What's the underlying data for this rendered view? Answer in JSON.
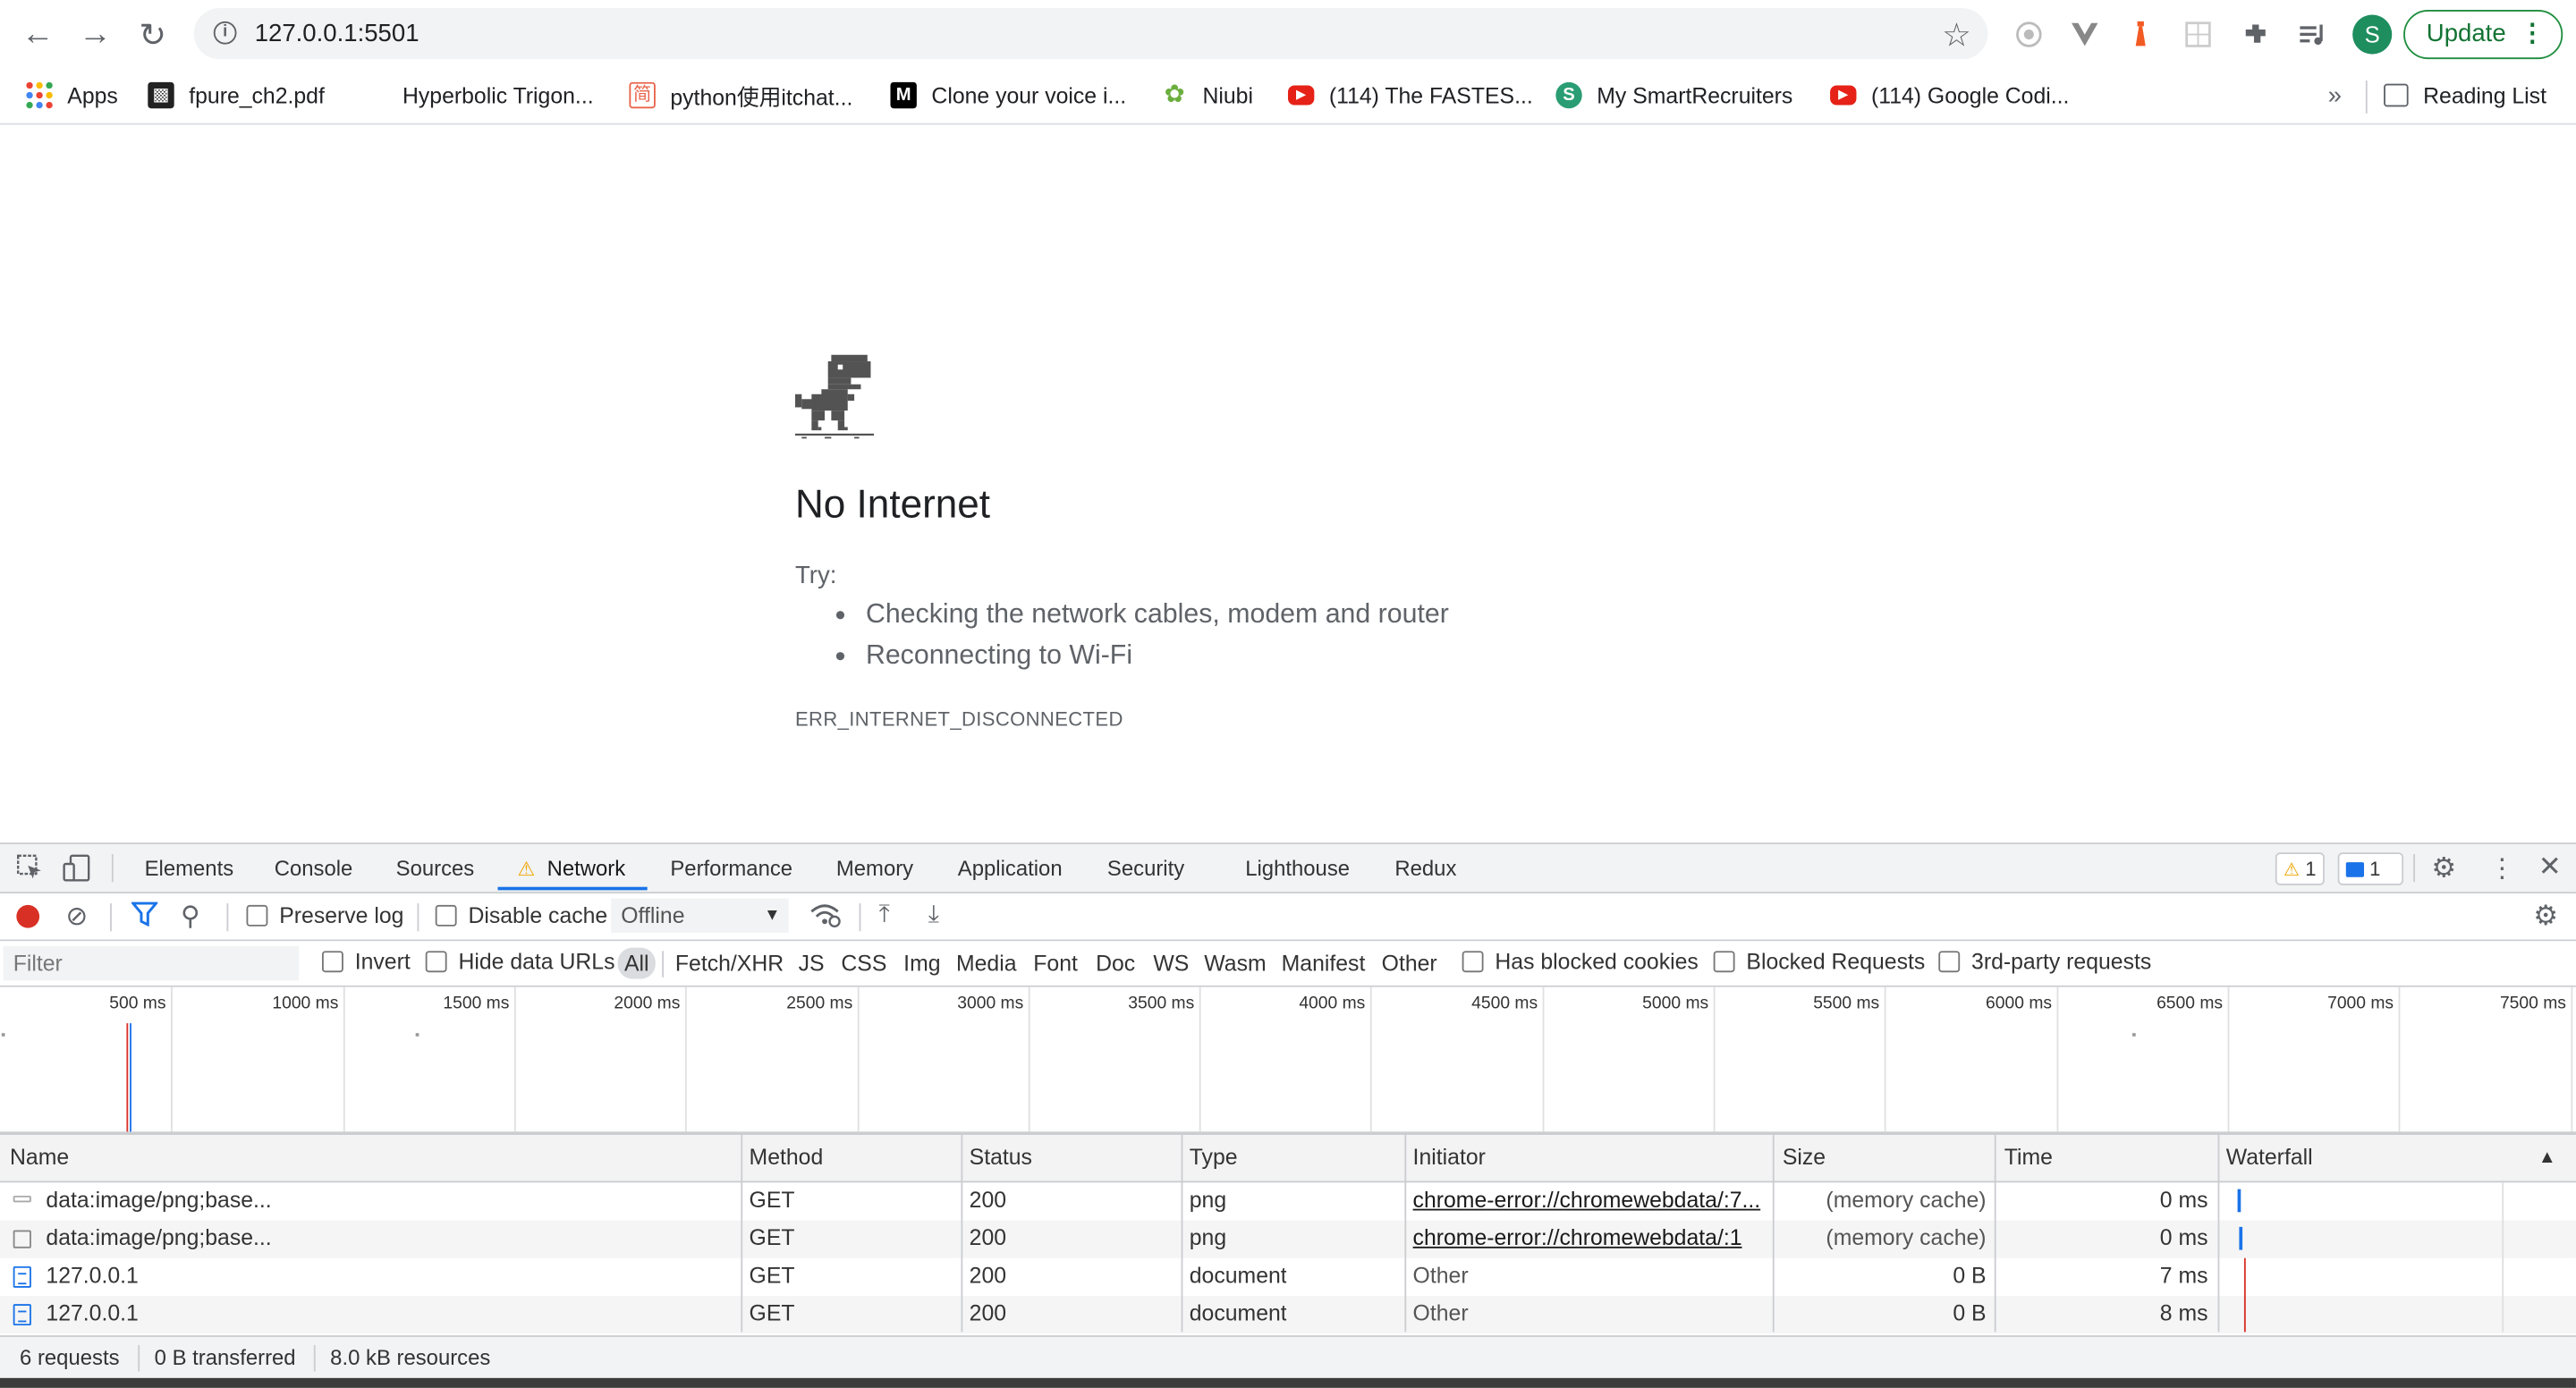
{
  "browser": {
    "url": "127.0.0.1:5501",
    "update_label": "Update",
    "avatar_letter": "S",
    "bookmarks": [
      {
        "label": "Apps",
        "icon": "apps-grid-icon"
      },
      {
        "label": "fpure_ch2.pdf",
        "icon": "pdf-icon"
      },
      {
        "label": "Hyperbolic Trigon...",
        "icon": "blank-icon"
      },
      {
        "label": "python使用itchat...",
        "icon": "jianshu-icon"
      },
      {
        "label": "Clone your voice i...",
        "icon": "medium-icon"
      },
      {
        "label": "Niubi",
        "icon": "leaf-icon"
      },
      {
        "label": "(114) The FASTES...",
        "icon": "youtube-icon"
      },
      {
        "label": "My SmartRecruiters",
        "icon": "smartrecruiters-icon"
      },
      {
        "label": "(114) Google Codi...",
        "icon": "youtube-icon"
      }
    ],
    "overflow_label": "»",
    "reading_list_label": "Reading List"
  },
  "page": {
    "headline": "No Internet",
    "try_label": "Try:",
    "suggestions": [
      "Checking the network cables, modem and router",
      "Reconnecting to Wi-Fi"
    ],
    "error_code": "ERR_INTERNET_DISCONNECTED"
  },
  "devtools": {
    "tabs": [
      "Elements",
      "Console",
      "Sources",
      "Network",
      "Performance",
      "Memory",
      "Application",
      "Security",
      "Lighthouse",
      "Redux"
    ],
    "active_tab": "Network",
    "warnings_count": "1",
    "messages_count": "1",
    "toolbar": {
      "preserve_log": "Preserve log",
      "disable_cache": "Disable cache",
      "throttle_value": "Offline"
    },
    "filter": {
      "placeholder": "Filter",
      "invert": "Invert",
      "hide_data_urls": "Hide data URLs",
      "types": [
        "All",
        "Fetch/XHR",
        "JS",
        "CSS",
        "Img",
        "Media",
        "Font",
        "Doc",
        "WS",
        "Wasm",
        "Manifest",
        "Other"
      ],
      "selected_type": "All",
      "has_blocked_cookies": "Has blocked cookies",
      "blocked_requests": "Blocked Requests",
      "third_party": "3rd-party requests"
    },
    "timeline_ticks": [
      "500 ms",
      "1000 ms",
      "1500 ms",
      "2000 ms",
      "2500 ms",
      "3000 ms",
      "3500 ms",
      "4000 ms",
      "4500 ms",
      "5000 ms",
      "5500 ms",
      "6000 ms",
      "6500 ms",
      "7000 ms",
      "7500 ms"
    ],
    "columns": [
      "Name",
      "Method",
      "Status",
      "Type",
      "Initiator",
      "Size",
      "Time",
      "Waterfall"
    ],
    "sort_indicator": "▲",
    "requests": [
      {
        "name": "data:image/png;base...",
        "method": "GET",
        "status": "200",
        "type": "png",
        "initiator": "chrome-error://chromewebdata/:7...",
        "size": "(memory cache)",
        "time": "0 ms"
      },
      {
        "name": "data:image/png;base...",
        "method": "GET",
        "status": "200",
        "type": "png",
        "initiator": "chrome-error://chromewebdata/:1",
        "size": "(memory cache)",
        "time": "0 ms"
      },
      {
        "name": "127.0.0.1",
        "method": "GET",
        "status": "200",
        "type": "document",
        "initiator": "Other",
        "size": "0 B",
        "time": "7 ms"
      },
      {
        "name": "127.0.0.1",
        "method": "GET",
        "status": "200",
        "type": "document",
        "initiator": "Other",
        "size": "0 B",
        "time": "8 ms"
      }
    ],
    "summary": {
      "requests": "6 requests",
      "transferred": "0 B transferred",
      "resources": "8.0 kB resources"
    }
  }
}
